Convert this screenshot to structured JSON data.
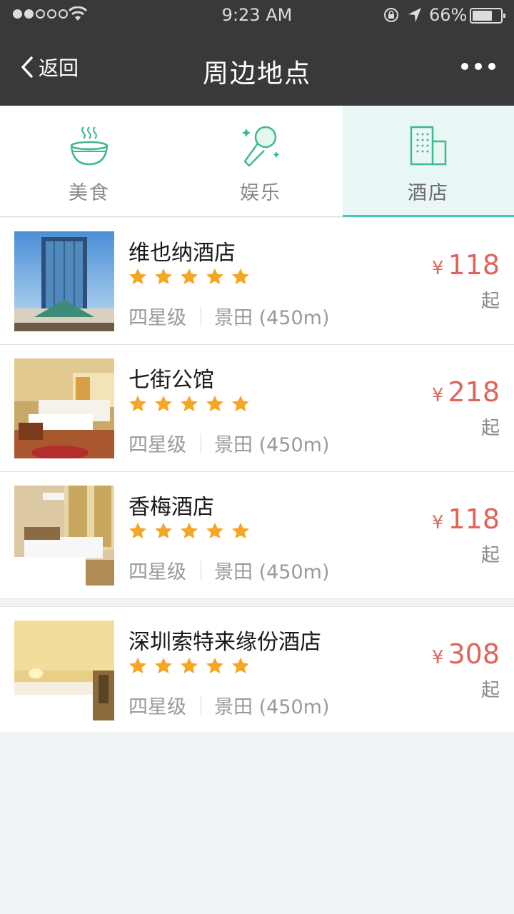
{
  "status_bar": {
    "time": "9:23 AM",
    "battery_pct": "66%"
  },
  "nav": {
    "back_label": "返回",
    "title": "周边地点"
  },
  "tabs": [
    {
      "label": "美食",
      "icon": "bowl-icon",
      "active": false
    },
    {
      "label": "娱乐",
      "icon": "microphone-icon",
      "active": false
    },
    {
      "label": "酒店",
      "icon": "building-icon",
      "active": true
    }
  ],
  "hotels": [
    {
      "name": "维也纳酒店",
      "rating": 5,
      "level": "四星级",
      "location": "景田 (450m)",
      "currency": "¥",
      "price": "118",
      "suffix": "起"
    },
    {
      "name": "七街公馆",
      "rating": 5,
      "level": "四星级",
      "location": "景田 (450m)",
      "currency": "¥",
      "price": "218",
      "suffix": "起"
    },
    {
      "name": "香梅酒店",
      "rating": 5,
      "level": "四星级",
      "location": "景田 (450m)",
      "currency": "¥",
      "price": "118",
      "suffix": "起"
    },
    {
      "name": "深圳索特来缘份酒店",
      "rating": 5,
      "level": "四星级",
      "location": "景田 (450m)",
      "currency": "¥",
      "price": "308",
      "suffix": "起"
    }
  ],
  "colors": {
    "nav_bg": "#39393b",
    "accent": "#4cc4b9",
    "price": "#e0645a",
    "star": "#f5a623"
  }
}
